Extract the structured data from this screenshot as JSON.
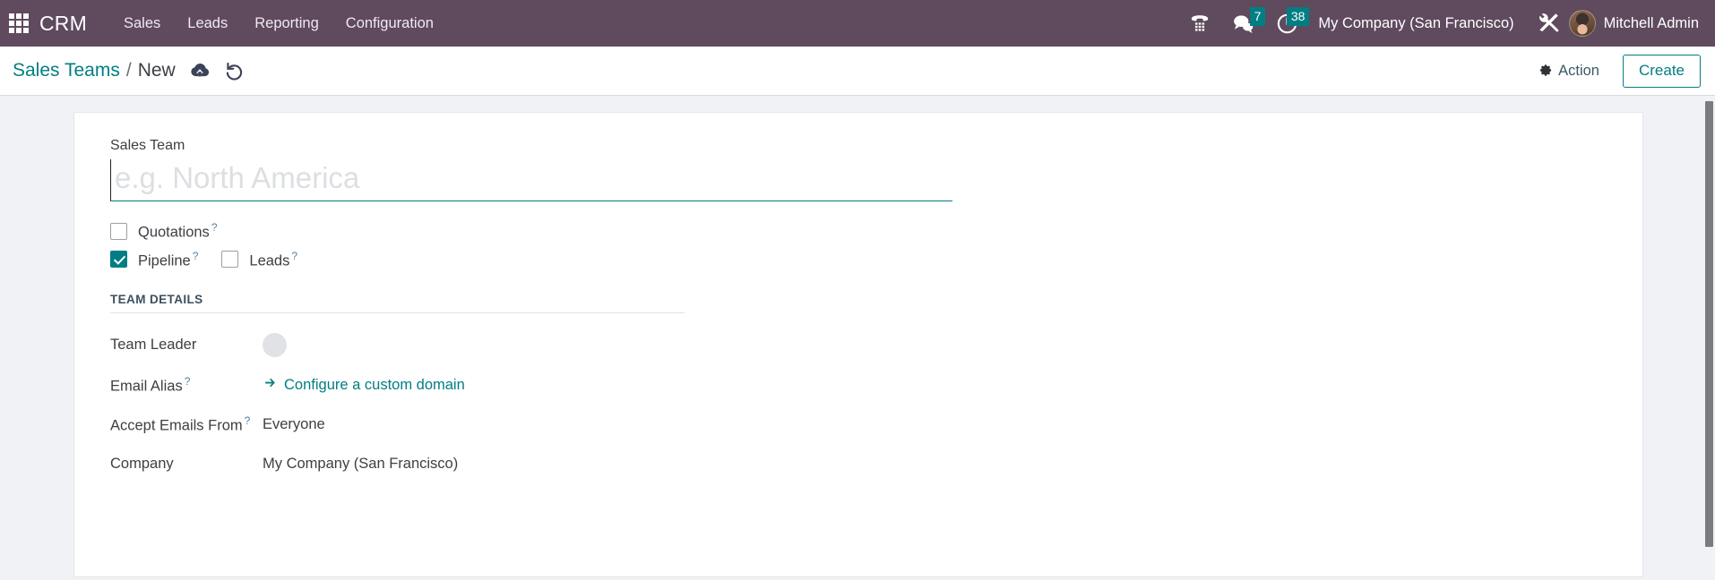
{
  "navbar": {
    "apps_icon": "apps-grid-icon",
    "brand": "CRM",
    "menu": [
      {
        "label": "Sales"
      },
      {
        "label": "Leads"
      },
      {
        "label": "Reporting"
      },
      {
        "label": "Configuration"
      }
    ],
    "systray": {
      "phone_icon": "phone-dialpad-icon",
      "messages_icon": "chat-bubbles-icon",
      "messages_count": "7",
      "activities_icon": "clock-icon",
      "activities_count": "38",
      "company": "My Company (San Francisco)",
      "tools_icon": "tools-icon",
      "avatar": "user-avatar",
      "user": "Mitchell Admin"
    }
  },
  "control_bar": {
    "breadcrumb_root": "Sales Teams",
    "breadcrumb_separator": "/",
    "breadcrumb_current": "New",
    "save_icon": "cloud-upload-icon",
    "discard_icon": "undo-icon",
    "action_icon": "gear-icon",
    "action_label": "Action",
    "create_label": "Create"
  },
  "form": {
    "name_label": "Sales Team",
    "name_value": "",
    "name_placeholder": "e.g. North America",
    "options": [
      {
        "label": "Quotations",
        "checked": false,
        "help": "?"
      },
      {
        "label": "Pipeline",
        "checked": true,
        "help": "?"
      },
      {
        "label": "Leads",
        "checked": false,
        "help": "?"
      }
    ],
    "section_title": "TEAM DETAILS",
    "rows": [
      {
        "label": "Team Leader",
        "help": "",
        "value": ""
      },
      {
        "label": "Email Alias",
        "help": "?",
        "value": "Configure a custom domain"
      },
      {
        "label": "Accept Emails From",
        "help": "?",
        "value": "Everyone"
      },
      {
        "label": "Company",
        "help": "",
        "value": "My Company (San Francisco)"
      }
    ],
    "link_arrow": "arrow-right-icon"
  },
  "colors": {
    "navbar_purple": "#5f4a5e",
    "accent_teal": "#017e84",
    "page_background": "#f0f2f5"
  }
}
